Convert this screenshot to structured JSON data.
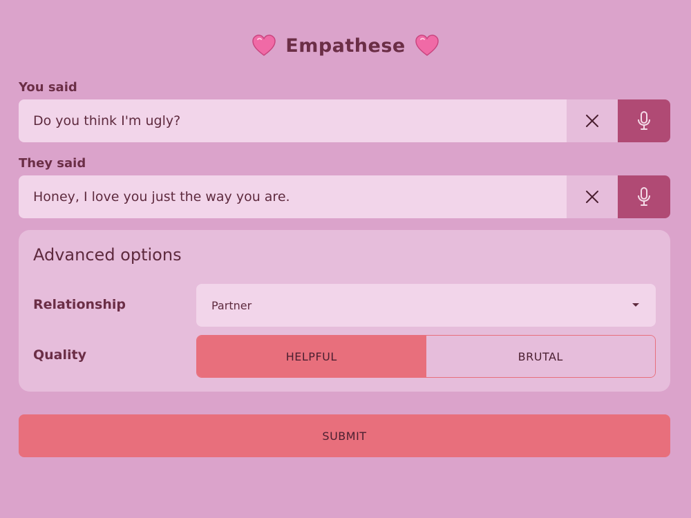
{
  "header": {
    "title": "Empathese",
    "left_icon": "pink-heart-icon",
    "right_icon": "pink-heart-icon"
  },
  "you_said": {
    "label": "You said",
    "value": "Do you think I'm ugly?",
    "clear_icon": "close-icon",
    "mic_icon": "microphone-icon"
  },
  "they_said": {
    "label": "They said",
    "value": "Honey, I love you just the way you are.",
    "clear_icon": "close-icon",
    "mic_icon": "microphone-icon"
  },
  "advanced": {
    "title": "Advanced options",
    "relationship": {
      "label": "Relationship",
      "selected": "Partner",
      "icon": "dropdown-arrow-icon"
    },
    "quality": {
      "label": "Quality",
      "options": [
        "HELPFUL",
        "BRUTAL"
      ],
      "selected": "HELPFUL"
    }
  },
  "submit": {
    "label": "SUBMIT"
  },
  "colors": {
    "background": "#dba3cb",
    "accent": "#e86f7c",
    "mic_button": "#b04a74",
    "input_bg": "#f2d5ea",
    "card_bg": "#e6bddb",
    "text": "#5e2a3e"
  }
}
